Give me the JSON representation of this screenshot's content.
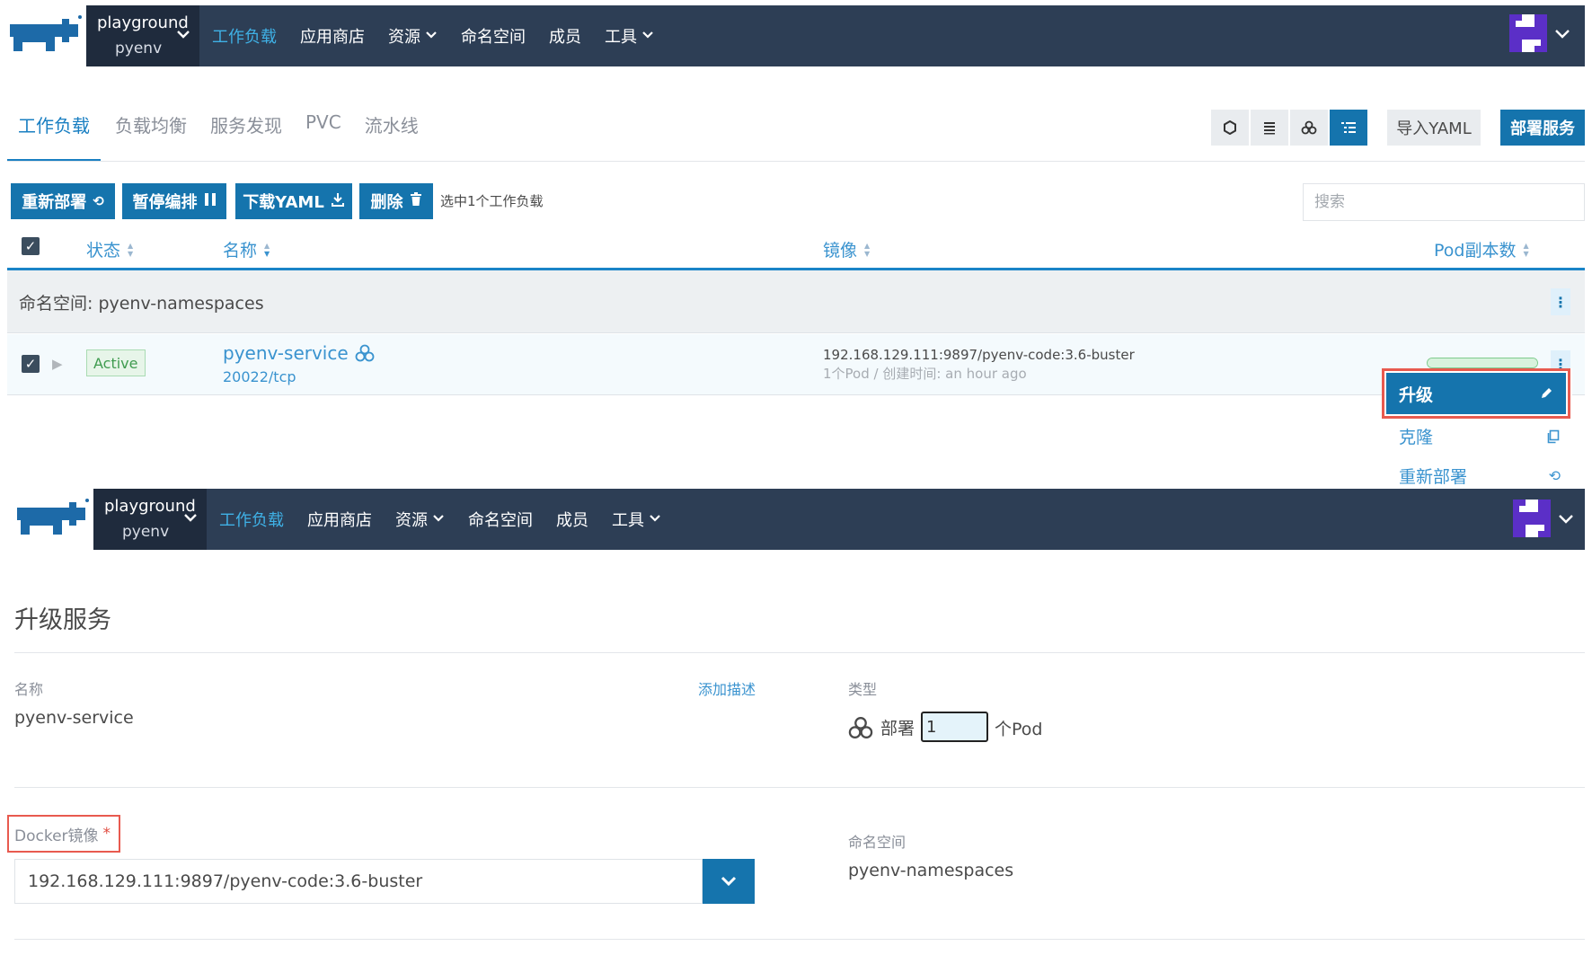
{
  "header": {
    "cluster": "playground",
    "project": "pyenv",
    "nav": [
      {
        "label": "工作负载",
        "has_caret": false,
        "active": true
      },
      {
        "label": "应用商店",
        "has_caret": false
      },
      {
        "label": "资源",
        "has_caret": true
      },
      {
        "label": "命名空间",
        "has_caret": false
      },
      {
        "label": "成员",
        "has_caret": false
      },
      {
        "label": "工具",
        "has_caret": true
      }
    ]
  },
  "tabs": [
    "工作负载",
    "负载均衡",
    "服务发现",
    "PVC",
    "流水线"
  ],
  "toolbar": {
    "import_yaml": "导入YAML",
    "deploy": "部署服务"
  },
  "bulk": {
    "redeploy": "重新部署",
    "pause": "暂停编排",
    "download_yaml": "下载YAML",
    "delete": "删除",
    "selected_text": "选中1个工作负载"
  },
  "search": {
    "placeholder": "搜索"
  },
  "table": {
    "columns": [
      "状态",
      "名称",
      "镜像",
      "Pod副本数"
    ],
    "group_label": "命名空间: pyenv-namespaces",
    "row": {
      "status": "Active",
      "name": "pyenv-service",
      "port": "20022/tcp",
      "image": "192.168.129.111:9897/pyenv-code:3.6-buster",
      "image_sub": "1个Pod / 创建时间: an hour ago",
      "pod_ready_fraction": 1.0
    }
  },
  "menu": {
    "upgrade": "升级",
    "clone": "克隆",
    "redeploy": "重新部署"
  },
  "upgrade_form": {
    "title": "升级服务",
    "name_label": "名称",
    "name_value": "pyenv-service",
    "add_desc": "添加描述",
    "type_label": "类型",
    "type_value": "部署",
    "pod_count": "1",
    "pod_unit": "个Pod",
    "docker_label": "Docker镜像",
    "required_mark": "*",
    "docker_value": "192.168.129.111:9897/pyenv-code:3.6-buster",
    "namespace_label": "命名空间",
    "namespace_value": "pyenv-namespaces"
  },
  "colors": {
    "nav_bg": "#2d3e55",
    "primary": "#1574ad",
    "link": "#3a93cf",
    "active_green": "#3f9b4f",
    "highlight_red": "#e85a4f"
  }
}
